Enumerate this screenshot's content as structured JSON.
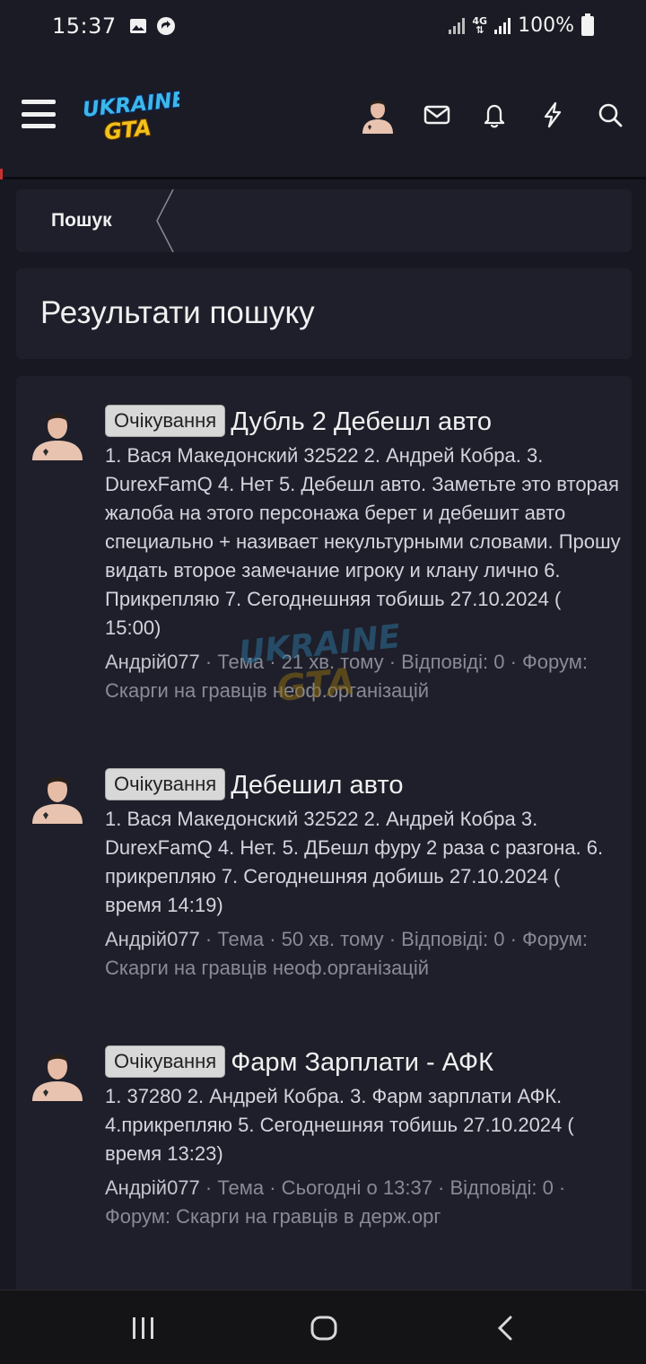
{
  "status_bar": {
    "time": "15:37",
    "network": "4G",
    "battery": "100%"
  },
  "header": {
    "logo_alt": "UKRAINE GTA",
    "icons": [
      "menu-icon",
      "avatar",
      "mail-icon",
      "bell-icon",
      "bolt-icon",
      "search-icon"
    ]
  },
  "breadcrumb": {
    "label": "Пошук"
  },
  "page": {
    "title": "Результати пошуку"
  },
  "results": [
    {
      "badge": "Очікування",
      "title": "Дубль 2 Дебешл авто",
      "snippet": "1. Вася Македонский 32522 2. Андрей Кобра. 3. DurexFamQ 4. Нет 5. Дебешл авто. Заметьте это вторая жалоба на этого персонажа берет и дебешит авто специально + називает некультурными словами. Прошу видать второе замечание игроку и клану лично 6. Прикрепляю 7. Сегоднешняя тобишь 27.10.2024 ( 15:00)",
      "author": "Андрій077",
      "meta": " · Тема · 21 хв. тому · Відповіді: 0 · Форум: Скарги на гравців неоф.організацій"
    },
    {
      "badge": "Очікування",
      "title": "Дебешил авто",
      "snippet": "1. Вася Македонский 32522 2. Андрей Кобра 3. DurexFamQ 4. Нет. 5. ДБешл фуру 2 раза с разгона. 6. прикрепляю 7. Сегоднешняя добишь 27.10.2024 ( время 14:19)",
      "author": "Андрій077",
      "meta": " · Тема · 50 хв. тому · Відповіді: 0 · Форум: Скарги на гравців неоф.організацій"
    },
    {
      "badge": "Очікування",
      "title": "Фарм Зарплати - АФК",
      "snippet": "1. 37280 2. Андрей Кобра. 3. Фарм зарплати АФК. 4.прикрепляю 5. Сегоднешняя тобишь 27.10.2024 ( время 13:23)",
      "author": "Андрій077",
      "meta": " · Тема · Сьогодні о 13:37 · Відповіді: 0 · Форум: Скарги на гравців в держ.орг"
    }
  ],
  "nav": {
    "icons": [
      "recent-apps-icon",
      "home-icon",
      "back-icon"
    ]
  },
  "colors": {
    "background": "#171821",
    "card": "#1e1f2a",
    "badge": "#d8d8d8"
  }
}
